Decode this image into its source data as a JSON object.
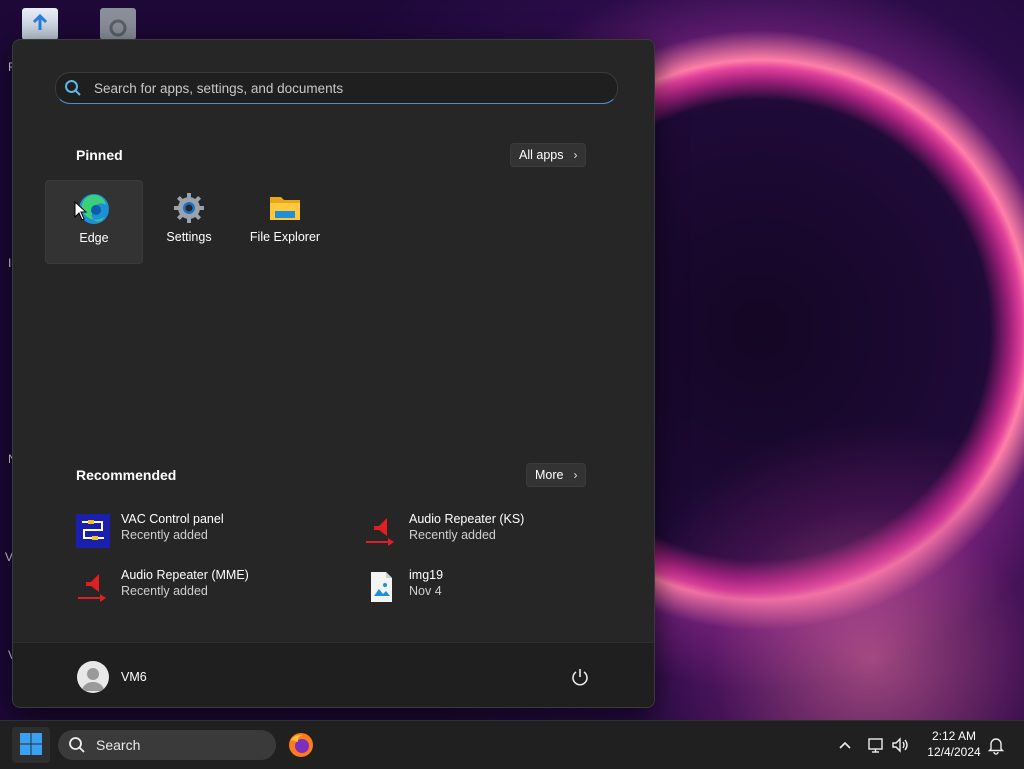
{
  "start_menu": {
    "search_placeholder": "Search for apps, settings, and documents",
    "pinned": {
      "title": "Pinned",
      "all_apps_label": "All apps",
      "apps": [
        {
          "label": "Edge",
          "icon": "edge-icon"
        },
        {
          "label": "Settings",
          "icon": "settings-gear-icon"
        },
        {
          "label": "File Explorer",
          "icon": "folder-icon"
        }
      ]
    },
    "recommended": {
      "title": "Recommended",
      "more_label": "More",
      "items": [
        {
          "name": "VAC Control panel",
          "sub": "Recently added",
          "icon": "vac-control-panel-icon"
        },
        {
          "name": "Audio Repeater (KS)",
          "sub": "Recently added",
          "icon": "audio-repeater-icon"
        },
        {
          "name": "Audio Repeater (MME)",
          "sub": "Recently added",
          "icon": "audio-repeater-icon"
        },
        {
          "name": "img19",
          "sub": "Nov 4",
          "icon": "image-file-icon"
        }
      ]
    },
    "user": {
      "name": "VM6"
    }
  },
  "taskbar": {
    "search_label": "Search",
    "time": "2:12 AM",
    "date": "12/4/2024"
  },
  "desktop": {
    "side_letters": [
      "R",
      "I",
      "N",
      "V",
      "V"
    ]
  },
  "colors": {
    "menu_bg": "#262626",
    "accent": "#4a90d9",
    "taskbar_bg": "#202020"
  }
}
